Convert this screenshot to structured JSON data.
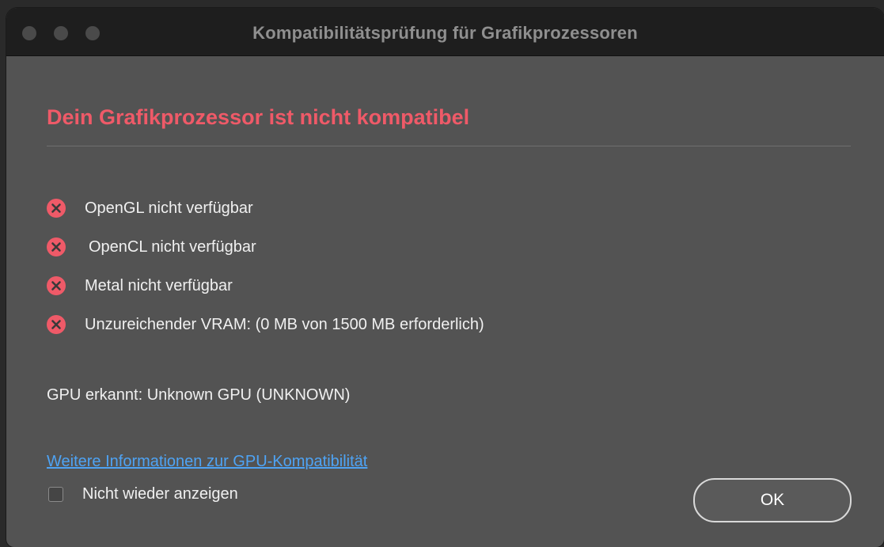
{
  "window": {
    "title": "Kompatibilitätsprüfung für Grafikprozessoren"
  },
  "dialog": {
    "headline": "Dein Grafikprozessor ist nicht kompatibel",
    "checks": [
      {
        "label": "OpenGL nicht verfügbar",
        "status": "error"
      },
      {
        "label": "OpenCL nicht verfügbar",
        "status": "error"
      },
      {
        "label": "Metal nicht verfügbar",
        "status": "error"
      },
      {
        "label": "Unzureichender VRAM: (0 MB von 1500 MB erforderlich)",
        "status": "error"
      }
    ],
    "gpu_detected": "GPU erkannt: Unknown GPU (UNKNOWN)",
    "info_link": "Weitere Informationen zur GPU-Kompatibilität",
    "dont_show_again": {
      "label": "Nicht wieder anzeigen",
      "checked": false
    },
    "ok_button": "OK"
  },
  "colors": {
    "headline": "#ef5a68",
    "error_icon": "#ef5a68",
    "link": "#4ea3f4",
    "background": "#535353",
    "titlebar": "#1e1e1e"
  },
  "icons": {
    "error": "error-x-circle-icon"
  }
}
